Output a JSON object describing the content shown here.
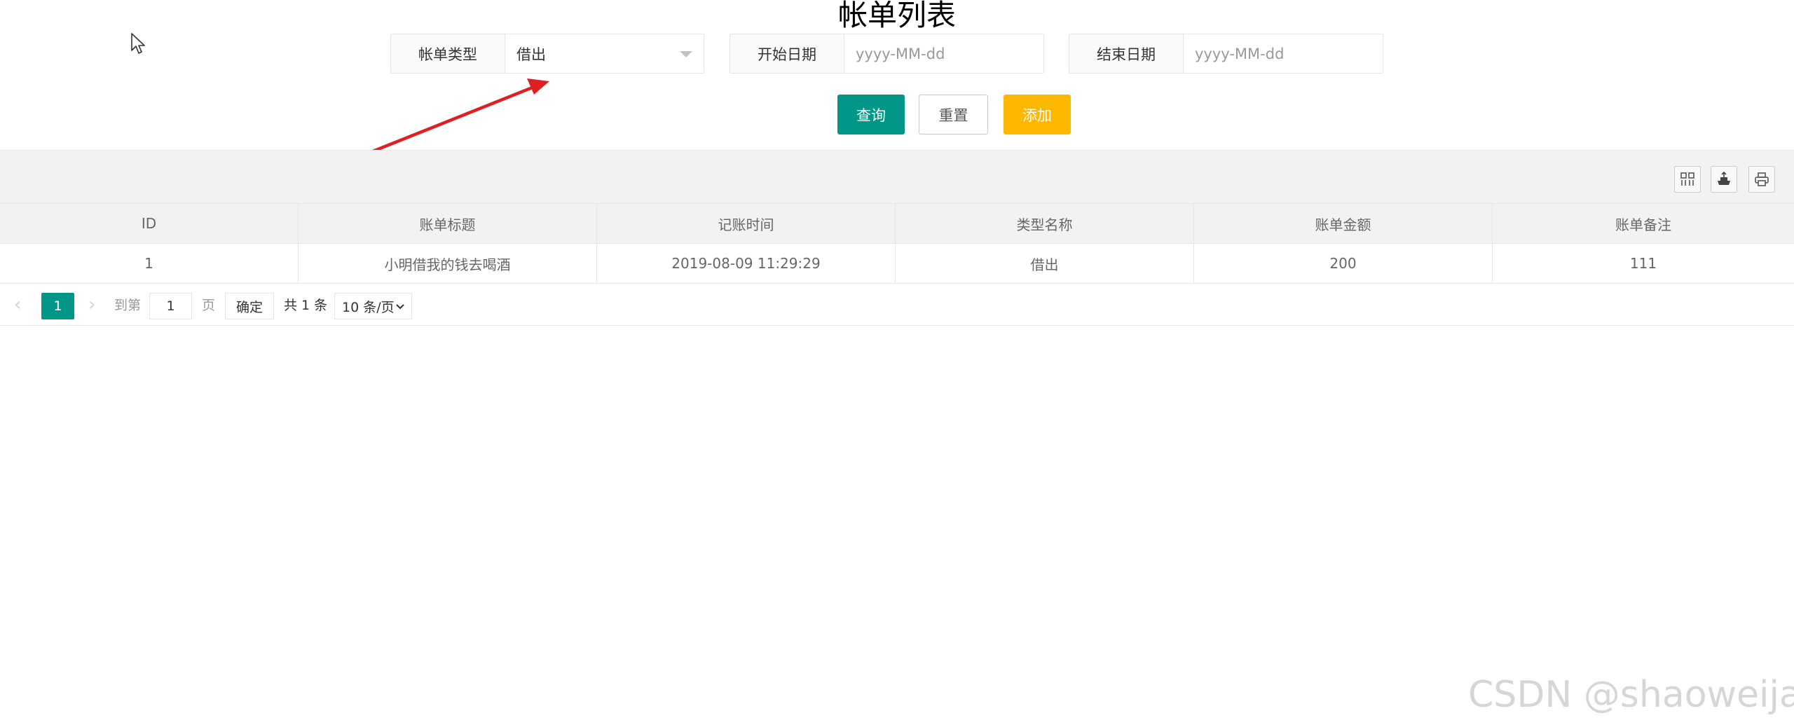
{
  "page": {
    "title": "帐单列表"
  },
  "filters": {
    "type_label": "帐单类型",
    "type_value": "借出",
    "start_label": "开始日期",
    "start_placeholder": "yyyy-MM-dd",
    "end_label": "结束日期",
    "end_placeholder": "yyyy-MM-dd"
  },
  "buttons": {
    "query": "查询",
    "reset": "重置",
    "add": "添加"
  },
  "colors": {
    "primary": "#009688",
    "warning": "#ffb800",
    "annotation_arrow": "#e02020"
  },
  "toolbar": {
    "icons": [
      "columns-filter-icon",
      "export-icon",
      "print-icon"
    ]
  },
  "table": {
    "columns": [
      "ID",
      "账单标题",
      "记账时间",
      "类型名称",
      "账单金额",
      "账单备注"
    ],
    "rows": [
      [
        "1",
        "小明借我的钱去喝酒",
        "2019-08-09 11:29:29",
        "借出",
        "200",
        "111"
      ]
    ]
  },
  "pager": {
    "current_page": "1",
    "goto_label": "到第",
    "goto_value": "1",
    "page_label": "页",
    "confirm": "确定",
    "total": "共 1 条",
    "page_size": "10 条/页"
  },
  "watermark": "CSDN @shaoweijava"
}
